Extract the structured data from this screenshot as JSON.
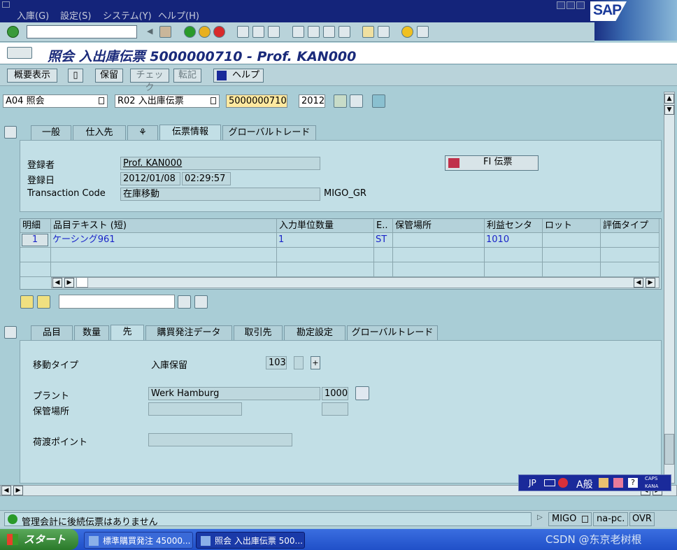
{
  "menu": {
    "items": [
      "入庫(G)",
      "設定(S)",
      "システム(Y)",
      "ヘルプ(H)"
    ]
  },
  "logo": {
    "text": "SAP"
  },
  "title": {
    "text": "照会 入出庫伝票 5000000710 - Prof. KAN000"
  },
  "appbar": {
    "overview": "概要表示",
    "save": "保留",
    "check": "チェック",
    "post": "転記",
    "help": "ヘルプ"
  },
  "header": {
    "action": "A04 照会",
    "doc_type": "R02 入出庫伝票",
    "doc_number": "5000000710",
    "year": "2012"
  },
  "top_tabs": [
    "一般",
    "仕入先",
    "伝票情報",
    "グローバルトレード"
  ],
  "docinfo": {
    "entered_by_label": "登録者",
    "entered_by": "Prof. KAN000",
    "entered_on_label": "登録日",
    "date": "2012/01/08",
    "time": "02:29:57",
    "tcode_label": "Transaction Code",
    "tcode_text": "在庫移動",
    "tcode": "MIGO_GR",
    "fi_button": "FI 伝票"
  },
  "grid": {
    "headers": [
      "明細",
      "品目テキスト (短)",
      "入力単位数量",
      "E..",
      "保管場所",
      "利益センタ",
      "ロット",
      "評価タイプ"
    ],
    "rows": [
      {
        "line": "1",
        "text": "ケーシング961",
        "qty": "1",
        "unit": "ST",
        "sloc": "",
        "pc": "1010",
        "batch": "",
        "valtype": ""
      }
    ]
  },
  "bottom_tabs": [
    "品目",
    "数量",
    "先",
    "購買発注データ",
    "取引先",
    "勘定設定",
    "グローバルトレード"
  ],
  "dest": {
    "mvt_label": "移動タイプ",
    "mvt_text": "入庫保留",
    "mvt_code": "103",
    "plus": "+",
    "plant_label": "プラント",
    "plant_name": "Werk Hamburg",
    "plant_code": "1000",
    "sloc_label": "保管場所",
    "unload_label": "荷渡ポイント"
  },
  "ime": {
    "lang": "JP",
    "mode": "A般",
    "caps": "CAPS",
    "kana": "KANA"
  },
  "status": {
    "message": "管理会計に後続伝票はありません",
    "tcode": "MIGO",
    "server": "na-pc.",
    "mode": "OVR"
  },
  "taskbar": {
    "start": "スタート",
    "tasks": [
      "標準購買発注 45000...",
      "照会 入出庫伝票 500..."
    ]
  },
  "watermark": "CSDN @东京老树根",
  "colors": {
    "menubar": "#14247a",
    "background": "#a9cdd6",
    "link": "#1a24c8"
  }
}
